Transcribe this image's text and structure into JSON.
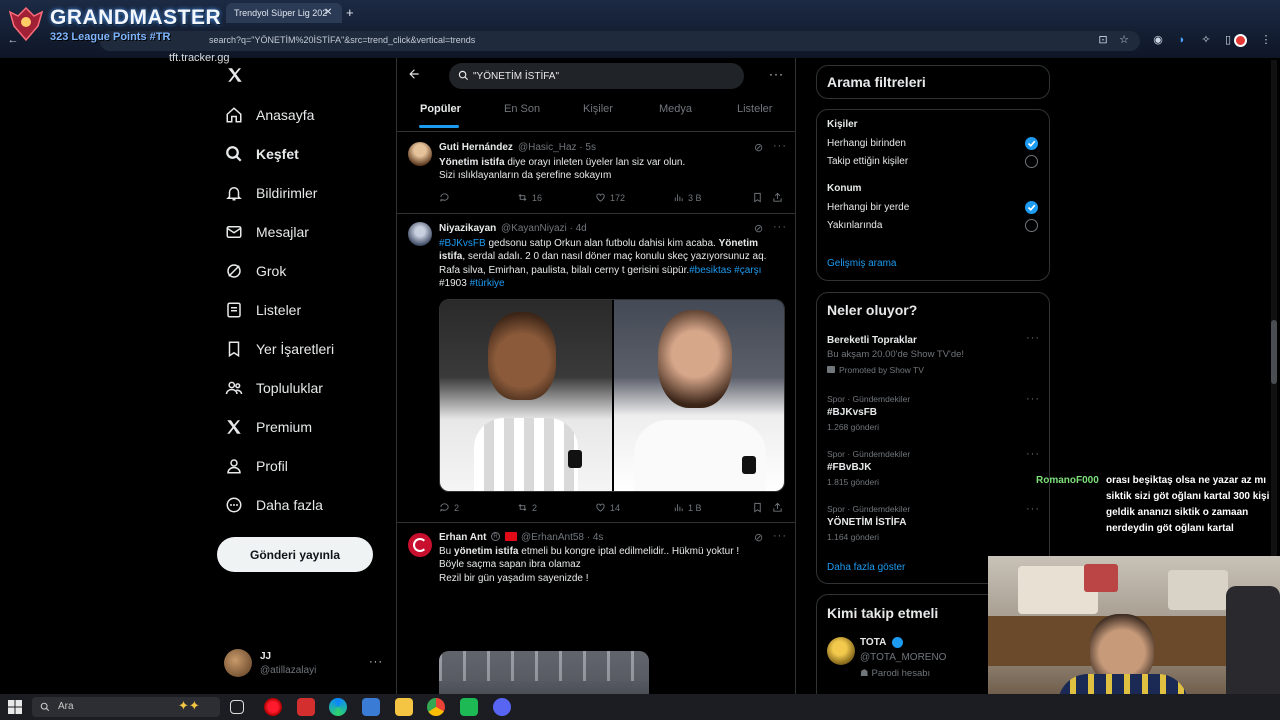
{
  "browser": {
    "tab_title": "Trendyol Süper Lig 202",
    "url": "search?q=\"YÖNETİM%20İSTİFA\"&src=trend_click&vertical=trends"
  },
  "overlay": {
    "title": "GRANDMASTER",
    "points": "323 League Points #TR",
    "site": "tft.tracker.gg"
  },
  "nav": {
    "items": [
      {
        "label": "Anasayfa",
        "icon": "home-icon"
      },
      {
        "label": "Keşfet",
        "icon": "search-icon"
      },
      {
        "label": "Bildirimler",
        "icon": "bell-icon"
      },
      {
        "label": "Mesajlar",
        "icon": "mail-icon"
      },
      {
        "label": "Grok",
        "icon": "grok-icon"
      },
      {
        "label": "Listeler",
        "icon": "list-icon"
      },
      {
        "label": "Yer İşaretleri",
        "icon": "bookmark-icon"
      },
      {
        "label": "Topluluklar",
        "icon": "people-icon"
      },
      {
        "label": "Premium",
        "icon": "x-logo-icon"
      },
      {
        "label": "Profil",
        "icon": "person-icon"
      },
      {
        "label": "Daha fazla",
        "icon": "more-circle-icon"
      }
    ],
    "post_button": "Gönderi yayınla",
    "account_name": "JJ",
    "account_handle": "@atillazalayi"
  },
  "search": {
    "query": "\"YÖNETİM İSTİFA\"",
    "tabs": [
      "Popüler",
      "En Son",
      "Kişiler",
      "Medya",
      "Listeler"
    ]
  },
  "tweets": [
    {
      "name": "Guti Hernández",
      "handle": "@Hasic_Haz · 5s",
      "bold": "Yönetim istifa",
      "line1_rest": " diye orayı inleten üyeler lan siz var olun.",
      "line2": "Sizi ıslıklayanların da şerefine sokayım",
      "replies": "",
      "retweets": "16",
      "likes": "172",
      "views": "3 B"
    },
    {
      "name": "Niyazikayan",
      "handle": "@KayanNiyazi · 4d",
      "hashtag1": "#BJKvsFB",
      "text1": " gedsonu satıp Orkun alan futbolu dahisi kim acaba. ",
      "bold1": "Yönetim",
      "bold2": "istifa",
      "text2": ", serdal adalı. 2 0 dan  nasıl döner maç konulu skeç yazıyorsunuz aq.",
      "text3": "Rafa silva, Emirhan, paulista, bilalı cerny t",
      "text3b": "gerisini süpür.",
      "hashtag2": "#besiktas",
      "hashtag3": "#çarşı",
      "text4": "#1903 ",
      "hashtag4": "#türkiye",
      "replies": "2",
      "retweets": "2",
      "likes": "14",
      "views": "1 B"
    },
    {
      "name": "Erhan Ant",
      "handle": "@ErhanAnt58 · 4s",
      "prefix": "Bu ",
      "bold": "yönetim istifa",
      "text1": " etmeli bu kongre iptal edilmelidir.. Hükmü yoktur !",
      "text2": "Böyle saçma sapan ibra olamaz",
      "text3": "Rezil bir gün yaşadım sayenizde !"
    }
  ],
  "filters": {
    "title": "Arama filtreleri",
    "people_heading": "Kişiler",
    "people_options": [
      "Herhangi birinden",
      "Takip ettiğin kişiler"
    ],
    "location_heading": "Konum",
    "location_options": [
      "Herhangi bir yerde",
      "Yakınlarında"
    ],
    "advanced_link": "Gelişmiş arama"
  },
  "trends": {
    "title": "Neler oluyor?",
    "promoted": {
      "name": "Bereketli Topraklar",
      "desc": "Bu akşam 20.00'de Show TV'de!",
      "by": "Promoted by Show TV"
    },
    "items": [
      {
        "category": "Spor · Gündemdekiler",
        "name": "#BJKvsFB",
        "count": "1.268 gönderi"
      },
      {
        "category": "Spor · Gündemdekiler",
        "name": "#FBvBJK",
        "count": "1.815 gönderi"
      },
      {
        "category": "Spor · Gündemdekiler",
        "name": "YÖNETİM İSTİFA",
        "count": "1.164 gönderi"
      }
    ],
    "show_more": "Daha fazla göster"
  },
  "who_to_follow": {
    "title": "Kimi takip etmeli",
    "name": "TOTA",
    "handle": "@TOTA_MORENO",
    "label": "Parodi hesabı"
  },
  "chat": {
    "user": "RomanoF000",
    "lines": [
      "orası beşiktaş olsa ne yazar az mı",
      "siktik sizi göt oğlanı kartal 300 kişi",
      "geldik ananızı siktik o zamaan",
      "nerdeydin göt oğlanı kartal"
    ]
  },
  "taskbar": {
    "search_placeholder": "Ara"
  },
  "colors": {
    "accent": "#1d9bf0",
    "background": "#000000",
    "border": "#2f3336",
    "muted": "#71767b"
  }
}
